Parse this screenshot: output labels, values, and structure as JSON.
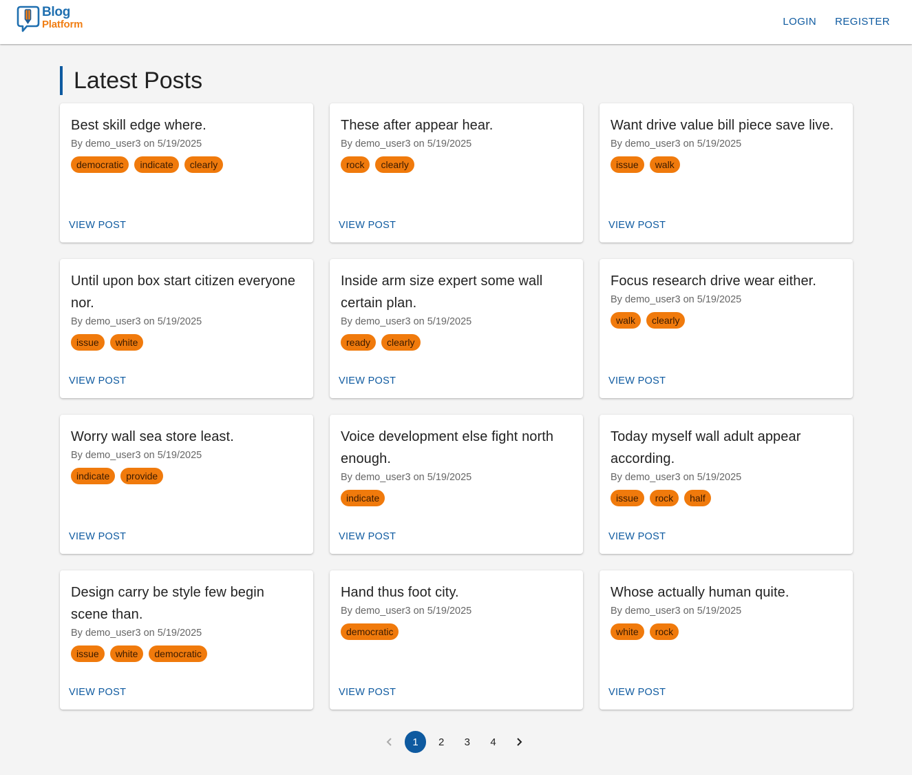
{
  "header": {
    "logo": {
      "line1": "Blog",
      "line2": "Platform"
    },
    "nav": [
      {
        "label": "LOGIN",
        "name": "login-link"
      },
      {
        "label": "REGISTER",
        "name": "register-link"
      }
    ]
  },
  "page_title": "Latest Posts",
  "view_label": "VIEW POST",
  "posts": [
    {
      "title": "Best skill edge where.",
      "meta": "By demo_user3 on 5/19/2025",
      "tags": [
        "democratic",
        "indicate",
        "clearly"
      ]
    },
    {
      "title": "These after appear hear.",
      "meta": "By demo_user3 on 5/19/2025",
      "tags": [
        "rock",
        "clearly"
      ]
    },
    {
      "title": "Want drive value bill piece save live.",
      "meta": "By demo_user3 on 5/19/2025",
      "tags": [
        "issue",
        "walk"
      ]
    },
    {
      "title": "Until upon box start citizen everyone nor.",
      "meta": "By demo_user3 on 5/19/2025",
      "tags": [
        "issue",
        "white"
      ]
    },
    {
      "title": "Inside arm size expert some wall certain plan.",
      "meta": "By demo_user3 on 5/19/2025",
      "tags": [
        "ready",
        "clearly"
      ]
    },
    {
      "title": "Focus research drive wear either.",
      "meta": "By demo_user3 on 5/19/2025",
      "tags": [
        "walk",
        "clearly"
      ]
    },
    {
      "title": "Worry wall sea store least.",
      "meta": "By demo_user3 on 5/19/2025",
      "tags": [
        "indicate",
        "provide"
      ]
    },
    {
      "title": "Voice development else fight north enough.",
      "meta": "By demo_user3 on 5/19/2025",
      "tags": [
        "indicate"
      ]
    },
    {
      "title": "Today myself wall adult appear according.",
      "meta": "By demo_user3 on 5/19/2025",
      "tags": [
        "issue",
        "rock",
        "half"
      ]
    },
    {
      "title": "Design carry be style few begin scene than.",
      "meta": "By demo_user3 on 5/19/2025",
      "tags": [
        "issue",
        "white",
        "democratic"
      ]
    },
    {
      "title": "Hand thus foot city.",
      "meta": "By demo_user3 on 5/19/2025",
      "tags": [
        "democratic"
      ]
    },
    {
      "title": "Whose actually human quite.",
      "meta": "By demo_user3 on 5/19/2025",
      "tags": [
        "white",
        "rock"
      ]
    }
  ],
  "pagination": {
    "pages": [
      "1",
      "2",
      "3",
      "4"
    ],
    "current": "1",
    "prev_icon": "chevron-left-icon",
    "next_icon": "chevron-right-icon"
  },
  "colors": {
    "primary": "#0e5aa0",
    "tag_background": "#f07a0c",
    "page_background": "#f4f4f4",
    "logo_orange": "#f07e14"
  }
}
